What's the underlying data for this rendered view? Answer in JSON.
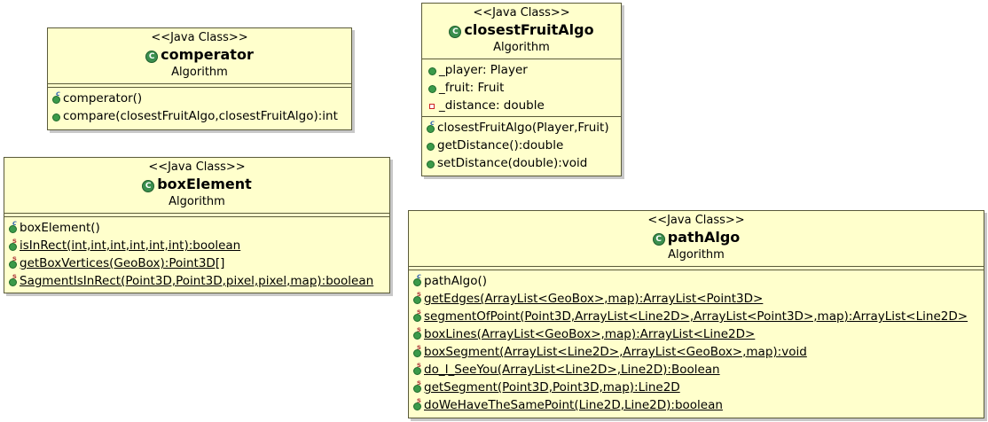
{
  "classes": {
    "comperator": {
      "stereotype": "<<Java Class>>",
      "name": "comperator",
      "package": "Algorithm",
      "ops": [
        "comperator()",
        "compare(closestFruitAlgo,closestFruitAlgo):int"
      ]
    },
    "closestFruitAlgo": {
      "stereotype": "<<Java Class>>",
      "name": "closestFruitAlgo",
      "package": "Algorithm",
      "attrs": [
        "_player: Player",
        "_fruit: Fruit",
        "_distance: double"
      ],
      "ops": [
        "closestFruitAlgo(Player,Fruit)",
        "getDistance():double",
        "setDistance(double):void"
      ]
    },
    "boxElement": {
      "stereotype": "<<Java Class>>",
      "name": "boxElement",
      "package": "Algorithm",
      "ops": [
        "boxElement()",
        "isInRect(int,int,int,int,int,int):boolean",
        "getBoxVertices(GeoBox):Point3D[]",
        "SagmentIsInRect(Point3D,Point3D,pixel,pixel,map):boolean"
      ]
    },
    "pathAlgo": {
      "stereotype": "<<Java Class>>",
      "name": "pathAlgo",
      "package": "Algorithm",
      "ops": [
        "pathAlgo()",
        "getEdges(ArrayList<GeoBox>,map):ArrayList<Point3D>",
        "segmentOfPoint(Point3D,ArrayList<Line2D>,ArrayList<Point3D>,map):ArrayList<Line2D>",
        "boxLines(ArrayList<GeoBox>,map):ArrayList<Line2D>",
        "boxSegment(ArrayList<Line2D>,ArrayList<GeoBox>,map):void",
        "do_I_SeeYou(ArrayList<Line2D>,Line2D):Boolean",
        "getSegment(Point3D,Point3D,map):Line2D",
        "doWeHaveTheSamePoint(Line2D,Line2D):boolean"
      ]
    }
  },
  "icons": {
    "class": "class-icon",
    "public": "public-dot-icon",
    "private": "private-square-icon",
    "constructor": "constructor-icon",
    "static": "static-icon"
  },
  "colors": {
    "class_fill": "#ffffcc",
    "border": "#5a5a3a",
    "public": "#3b9a4a",
    "private": "#cc2222"
  }
}
